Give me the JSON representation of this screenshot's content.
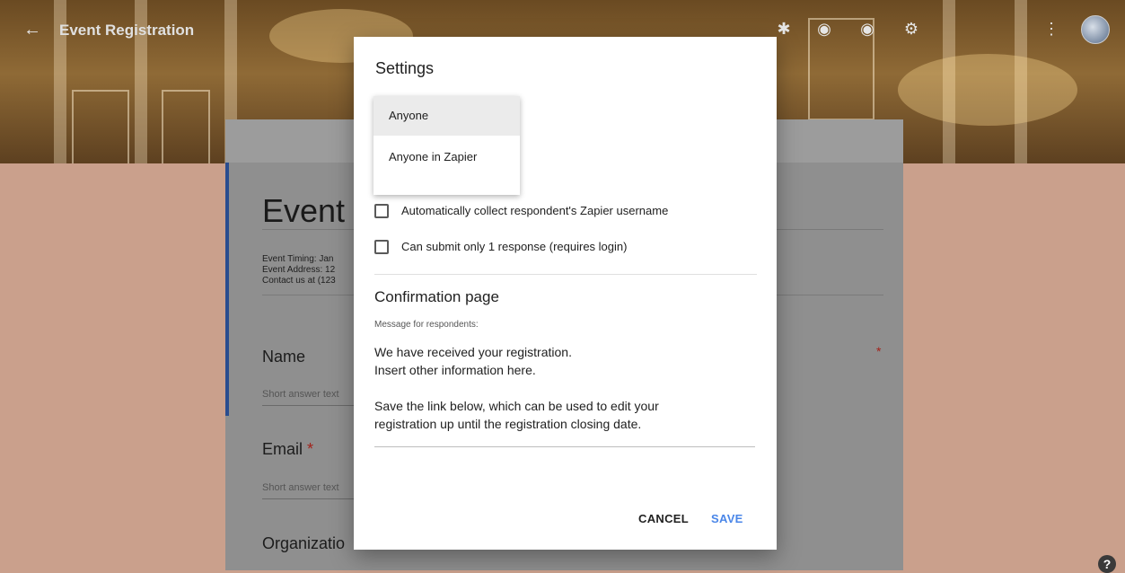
{
  "topbar": {
    "back_icon": "back-arrow-icon",
    "title": "Event Registration",
    "icons": [
      "puzzle-icon",
      "palette-icon",
      "eye-icon",
      "gear-icon",
      "more-vert-icon"
    ],
    "avatar": "avatar"
  },
  "form": {
    "title_partial": "Event r",
    "description_lines": [
      "Event Timing: Jan",
      "Event Address: 12",
      "Contact us at (123"
    ],
    "questions": [
      {
        "label": "Name",
        "required": true,
        "placeholder": "Short answer text"
      },
      {
        "label": "Email",
        "required": true,
        "placeholder": "Short answer text"
      },
      {
        "label": "Organizatio",
        "required": false
      }
    ]
  },
  "dialog": {
    "title": "Settings",
    "dropdown_options": [
      {
        "label": "Anyone",
        "selected": true
      },
      {
        "label": "Anyone in Zapier",
        "selected": false
      }
    ],
    "checkboxes": [
      {
        "label": "Automatically collect respondent's Zapier username",
        "checked": false
      },
      {
        "label": "Can submit only 1 response (requires login)",
        "checked": false
      }
    ],
    "confirmation_title": "Confirmation page",
    "message_caption": "Message for respondents:",
    "message_lines": [
      "We have received your registration.",
      "Insert other information here.",
      "",
      "Save the link below, which can be used to edit your",
      "registration up until the registration closing date."
    ],
    "cancel_label": "CANCEL",
    "save_label": "SAVE"
  },
  "help": {
    "label": "?"
  },
  "colors": {
    "accent": "#4a86e8",
    "required": "#a3221a",
    "form_accent": "#2a4d8f"
  }
}
